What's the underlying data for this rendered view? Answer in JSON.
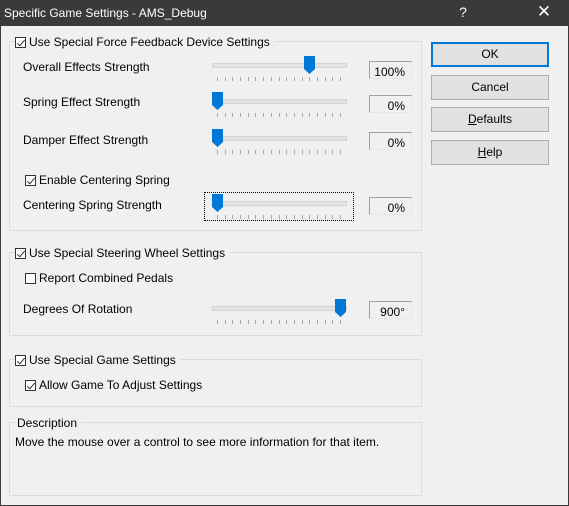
{
  "window": {
    "title": "Specific Game Settings - AMS_Debug",
    "help_glyph": "?",
    "close_glyph": "✕"
  },
  "force_feedback": {
    "enabled_label": "Use Special Force Feedback Device Settings",
    "enabled": true,
    "sliders": [
      {
        "label": "Overall Effects Strength",
        "value": "100%",
        "position": 0.75
      },
      {
        "label": "Spring Effect Strength",
        "value": "0%",
        "position": 0.0
      },
      {
        "label": "Damper Effect Strength",
        "value": "0%",
        "position": 0.0
      }
    ],
    "centering_label": "Enable Centering Spring",
    "centering_enabled": true,
    "centering_slider": {
      "label": "Centering Spring Strength",
      "value": "0%",
      "position": 0.0
    }
  },
  "steering": {
    "enabled_label": "Use Special Steering Wheel Settings",
    "enabled": true,
    "combined_pedals_label": "Report Combined Pedals",
    "combined_pedals": false,
    "rotation_slider": {
      "label": "Degrees Of Rotation",
      "value": "900°",
      "position": 1.0
    }
  },
  "game": {
    "enabled_label": "Use Special Game Settings",
    "enabled": true,
    "allow_adjust_label": "Allow Game To Adjust Settings",
    "allow_adjust": true
  },
  "description": {
    "title": "Description",
    "text": "Move the mouse over a control to see more information for that item."
  },
  "buttons": {
    "ok": "OK",
    "cancel": "Cancel",
    "defaults_mnemonic": "D",
    "defaults_rest": "efaults",
    "help_mnemonic": "H",
    "help_rest": "elp"
  },
  "colors": {
    "accent": "#0078d7",
    "titlebar": "#3a3a3a",
    "background": "#f0f0f0"
  }
}
